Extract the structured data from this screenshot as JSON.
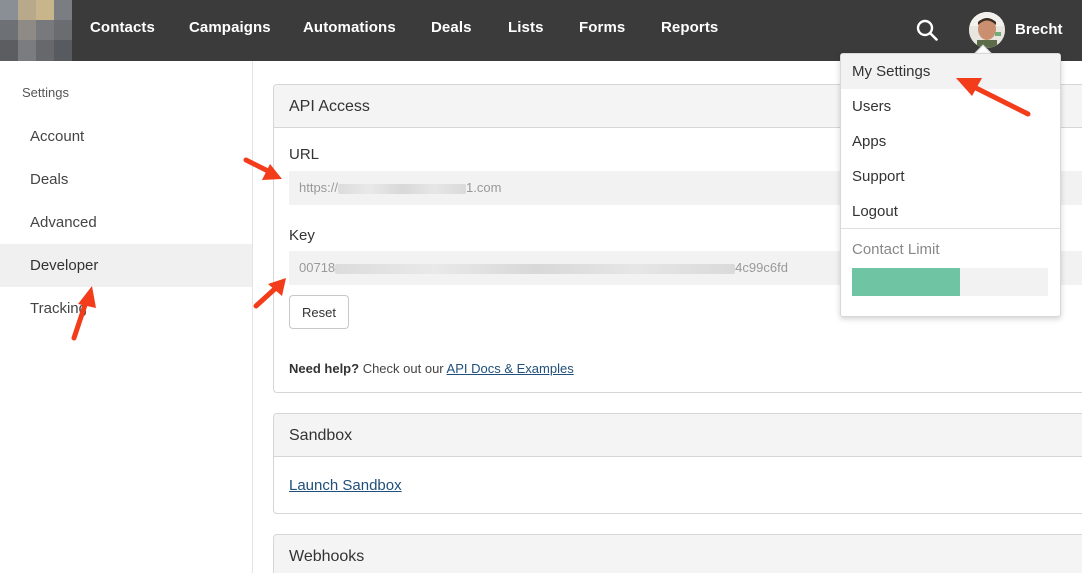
{
  "nav": {
    "items": [
      "Contacts",
      "Campaigns",
      "Automations",
      "Deals",
      "Lists",
      "Forms",
      "Reports"
    ],
    "search_icon": "search-icon",
    "user_name": "Brecht"
  },
  "sidebar": {
    "heading": "Settings",
    "items": [
      "Account",
      "Deals",
      "Advanced",
      "Developer",
      "Tracking"
    ],
    "active": "Developer"
  },
  "api_access": {
    "title": "API Access",
    "url_label": "URL",
    "url_prefix": "https://",
    "url_suffix": "1.com",
    "key_label": "Key",
    "key_prefix": "00718",
    "key_suffix": "4c99c6fd",
    "reset_label": "Reset",
    "help_bold": "Need help?",
    "help_text": " Check out our ",
    "help_link": "API Docs & Examples"
  },
  "sandbox": {
    "title": "Sandbox",
    "link": "Launch Sandbox"
  },
  "webhooks": {
    "title": "Webhooks"
  },
  "dropdown": {
    "items": [
      "My Settings",
      "Users",
      "Apps",
      "Support",
      "Logout"
    ],
    "highlighted": "My Settings",
    "limit_label": "Contact Limit",
    "limit_fraction": 0.55,
    "limit_color": "#6fc4a3"
  },
  "colors": {
    "topbar": "#3b3b3b",
    "annotation_arrow": "#f23c1a"
  }
}
